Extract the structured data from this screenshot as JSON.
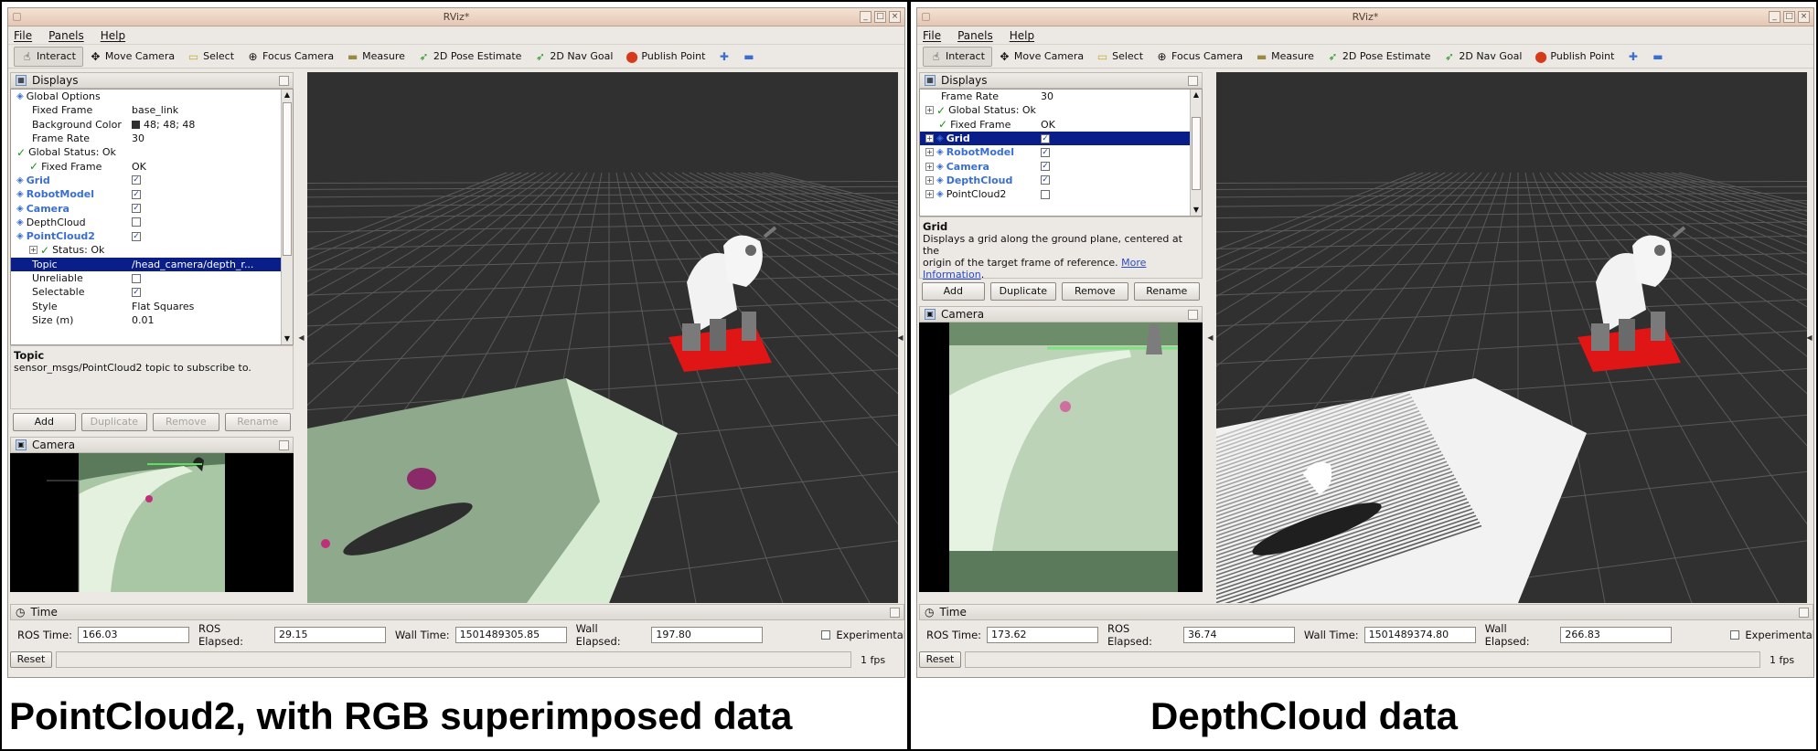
{
  "left": {
    "window_title": "RViz*",
    "menu": [
      "File",
      "Panels",
      "Help"
    ],
    "tools": [
      {
        "label": "Interact",
        "icon": "hand-cursor-icon"
      },
      {
        "label": "Move Camera",
        "icon": "move-camera-icon"
      },
      {
        "label": "Select",
        "icon": "select-box-icon"
      },
      {
        "label": "Focus Camera",
        "icon": "crosshair-icon"
      },
      {
        "label": "Measure",
        "icon": "ruler-icon"
      },
      {
        "label": "2D Pose Estimate",
        "icon": "green-arrow-icon"
      },
      {
        "label": "2D Nav Goal",
        "icon": "green-arrow-icon"
      },
      {
        "label": "Publish Point",
        "icon": "red-pin-icon"
      }
    ],
    "displays_title": "Displays",
    "tree": [
      {
        "label": "Global Options",
        "value": "",
        "indent": 0,
        "kind": "group"
      },
      {
        "label": "Fixed Frame",
        "value": "base_link",
        "indent": 1
      },
      {
        "label": "Background Color",
        "value": "48; 48; 48",
        "indent": 1,
        "swatch": "#303030"
      },
      {
        "label": "Frame Rate",
        "value": "30",
        "indent": 1
      },
      {
        "label": "Global Status: Ok",
        "value": "",
        "indent": 0,
        "check": true
      },
      {
        "label": "Fixed Frame",
        "value": "OK",
        "indent": 1,
        "check": true
      },
      {
        "label": "Grid",
        "value": "",
        "indent": 0,
        "blue": true,
        "cb": true
      },
      {
        "label": "RobotModel",
        "value": "",
        "indent": 0,
        "blue": true,
        "cb": true
      },
      {
        "label": "Camera",
        "value": "",
        "indent": 0,
        "blue": true,
        "cb": true
      },
      {
        "label": "DepthCloud",
        "value": "",
        "indent": 0,
        "cb": false
      },
      {
        "label": "PointCloud2",
        "value": "",
        "indent": 0,
        "blue": true,
        "cb": true
      },
      {
        "label": "Status: Ok",
        "value": "",
        "indent": 1,
        "check": true,
        "exp": true
      },
      {
        "label": "Topic",
        "value": "/head_camera/depth_r...",
        "indent": 1,
        "sel": true
      },
      {
        "label": "Unreliable",
        "value": "",
        "indent": 1,
        "cb": false
      },
      {
        "label": "Selectable",
        "value": "",
        "indent": 1,
        "cb": true
      },
      {
        "label": "Style",
        "value": "Flat Squares",
        "indent": 1
      },
      {
        "label": "Size (m)",
        "value": "0.01",
        "indent": 1
      }
    ],
    "desc_title": "Topic",
    "desc_text": "sensor_msgs/PointCloud2 topic to subscribe to.",
    "buttons": [
      "Add",
      "Duplicate",
      "Remove",
      "Rename"
    ],
    "camera_title": "Camera",
    "time_title": "Time",
    "ros_time_label": "ROS Time:",
    "ros_time": "166.03",
    "ros_elapsed_label": "ROS Elapsed:",
    "ros_elapsed": "29.15",
    "wall_time_label": "Wall Time:",
    "wall_time": "1501489305.85",
    "wall_elapsed_label": "Wall Elapsed:",
    "wall_elapsed": "197.80",
    "experimental": "Experimental",
    "reset": "Reset",
    "fps": "1 fps",
    "caption": "PointCloud2, with RGB superimposed data"
  },
  "right": {
    "window_title": "RViz*",
    "menu": [
      "File",
      "Panels",
      "Help"
    ],
    "displays_title": "Displays",
    "tree": [
      {
        "label": "Frame Rate",
        "value": "30",
        "indent": 1
      },
      {
        "label": "Global Status: Ok",
        "value": "",
        "indent": 0,
        "check": true,
        "exp": true
      },
      {
        "label": "Fixed Frame",
        "value": "OK",
        "indent": 1,
        "check": true
      },
      {
        "label": "Grid",
        "value": "",
        "indent": 0,
        "blue": true,
        "cb": true,
        "sel": true,
        "exp": true
      },
      {
        "label": "RobotModel",
        "value": "",
        "indent": 0,
        "blue": true,
        "cb": true,
        "exp": true
      },
      {
        "label": "Camera",
        "value": "",
        "indent": 0,
        "blue": true,
        "cb": true,
        "exp": true
      },
      {
        "label": "DepthCloud",
        "value": "",
        "indent": 0,
        "blue": true,
        "cb": true,
        "exp": true
      },
      {
        "label": "PointCloud2",
        "value": "",
        "indent": 0,
        "cb": false,
        "exp": true
      }
    ],
    "desc_title": "Grid",
    "desc_text1": "Displays a grid along the ground plane, centered at the",
    "desc_text2": "origin of the target frame of reference.",
    "desc_link": "More Information",
    "buttons": [
      "Add",
      "Duplicate",
      "Remove",
      "Rename"
    ],
    "camera_title": "Camera",
    "time_title": "Time",
    "ros_time_label": "ROS Time:",
    "ros_time": "173.62",
    "ros_elapsed_label": "ROS Elapsed:",
    "ros_elapsed": "36.74",
    "wall_time_label": "Wall Time:",
    "wall_time": "1501489374.80",
    "wall_elapsed_label": "Wall Elapsed:",
    "wall_elapsed": "266.83",
    "experimental": "Experimental",
    "reset": "Reset",
    "fps": "1 fps",
    "caption": "DepthCloud data"
  },
  "colors": {
    "grid_bg": "#303030",
    "robot_base": "#e01515",
    "selection": "#0a1e8a",
    "link": "#2a49c9"
  }
}
